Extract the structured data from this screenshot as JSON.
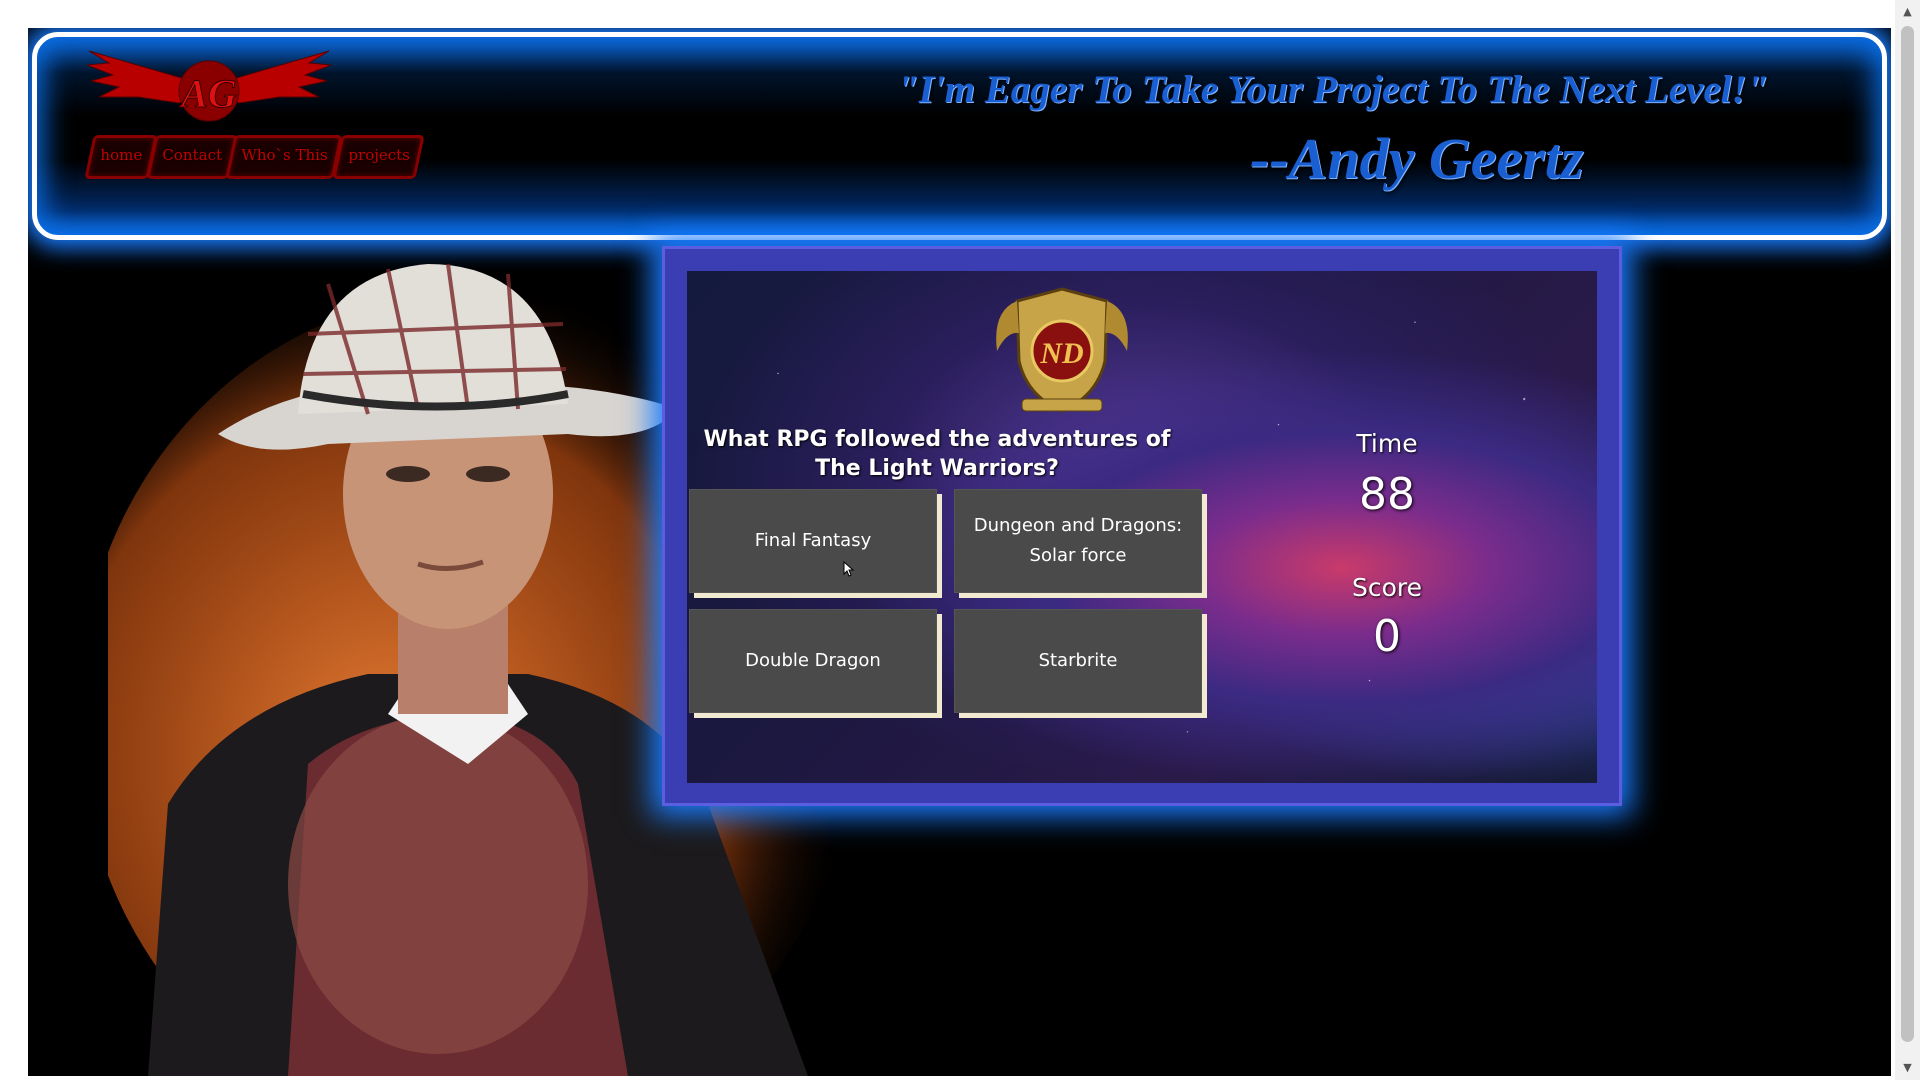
{
  "header": {
    "quote": "\"I'm Eager To Take Your Project To The Next Level!\"",
    "author": "--Andy Geertz",
    "logo_text": "AG"
  },
  "nav": {
    "items": [
      {
        "label": "home"
      },
      {
        "label": "Contact"
      },
      {
        "label": "Who`s This"
      },
      {
        "label": "projects"
      }
    ]
  },
  "game": {
    "crest_text": "ND",
    "question": "What RPG followed the adventures of The Light Warriors?",
    "answers": [
      {
        "label": "Final Fantasy"
      },
      {
        "label": "Dungeon and Dragons: Solar force"
      },
      {
        "label": "Double Dragon"
      },
      {
        "label": "Starbrite"
      }
    ],
    "time_label": "Time",
    "time_value": "88",
    "score_label": "Score",
    "score_value": "0"
  },
  "colors": {
    "header_glow": "#1a7cff",
    "quote_blue": "#1a5fd1",
    "nav_red": "#c40000",
    "game_frame": "#3b3db3",
    "answer_bg": "#4a4a4a"
  }
}
